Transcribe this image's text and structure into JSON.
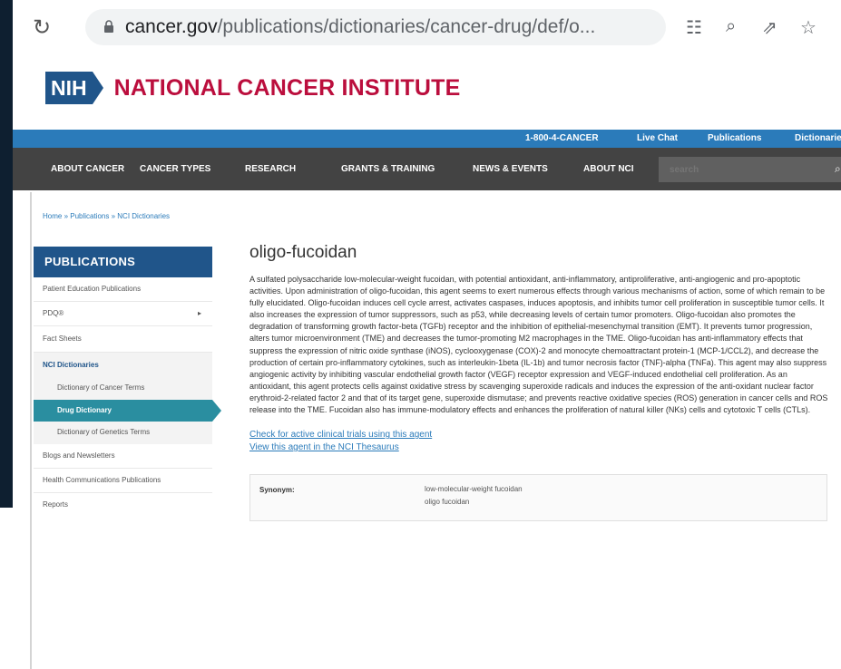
{
  "browser": {
    "url_domain": "cancer.gov",
    "url_path": "/publications/dictionaries/cancer-drug/def/o..."
  },
  "header": {
    "nih_logo": "NIH",
    "institute_name": "NATIONAL CANCER INSTITUTE",
    "colors": {
      "nih_blue": "#20558a",
      "brand_red": "#bb0e3d",
      "utility_blue": "#2b7bba",
      "nav_gray": "#434343",
      "active_teal": "#2a8ea0"
    }
  },
  "utility_nav": [
    "1-800-4-CANCER",
    "Live Chat",
    "Publications",
    "Dictionaries"
  ],
  "main_nav": {
    "items": [
      "ABOUT CANCER",
      "CANCER TYPES",
      "RESEARCH",
      "GRANTS & TRAINING",
      "NEWS & EVENTS",
      "ABOUT NCI"
    ],
    "search_placeholder": "search"
  },
  "breadcrumb": "Home » Publications » NCI Dictionaries",
  "sidebar": {
    "title": "PUBLICATIONS",
    "items": {
      "patient_education": "Patient Education Publications",
      "pdq": "PDQ®",
      "fact_sheets": "Fact Sheets",
      "nci_dictionaries": "NCI Dictionaries",
      "dict_cancer_terms": "Dictionary of Cancer Terms",
      "drug_dictionary": "Drug Dictionary",
      "dict_genetics_terms": "Dictionary of Genetics Terms",
      "blogs": "Blogs and Newsletters",
      "health_comm": "Health Communications Publications",
      "reports": "Reports"
    }
  },
  "main": {
    "term": "oligo-fucoidan",
    "definition": "A sulfated polysaccharide low-molecular-weight fucoidan, with potential antioxidant, anti-inflammatory, antiproliferative, anti-angiogenic and pro-apoptotic activities. Upon administration of oligo-fucoidan, this agent seems to exert numerous effects through various mechanisms of action, some of which remain to be fully elucidated. Oligo-fucoidan induces cell cycle arrest, activates caspases, induces apoptosis, and inhibits tumor cell proliferation in susceptible tumor cells. It also increases the expression of tumor suppressors, such as p53, while decreasing levels of certain tumor promoters. Oligo-fucoidan also promotes the degradation of transforming growth factor-beta (TGFb) receptor and the inhibition of epithelial-mesenchymal transition (EMT). It prevents tumor progression, alters tumor microenvironment (TME) and decreases the tumor-promoting M2 macrophages in the TME. Oligo-fucoidan has anti-inflammatory effects that suppress the expression of nitric oxide synthase (iNOS), cyclooxygenase (COX)-2 and monocyte chemoattractant protein-1 (MCP-1/CCL2), and decrease the production of certain pro-inflammatory cytokines, such as interleukin-1beta (IL-1b) and tumor necrosis factor (TNF)-alpha (TNFa). This agent may also suppress angiogenic activity by inhibiting vascular endothelial growth factor (VEGF) receptor expression and VEGF-induced endothelial cell proliferation. As an antioxidant, this agent protects cells against oxidative stress by scavenging superoxide radicals and induces the expression of the anti-oxidant nuclear factor erythroid-2-related factor 2 and that of its target gene, superoxide dismutase; and prevents reactive oxidative species (ROS) generation in cancer cells and ROS release into the TME. Fucoidan also has immune-modulatory effects and enhances the proliferation of natural killer (NKs) cells and cytotoxic T cells (CTLs).",
    "link_trials": "Check for active clinical trials using this agent",
    "link_thesaurus": "View this agent in the NCI Thesaurus",
    "synonym_label": "Synonym:",
    "synonyms": [
      "low-molecular-weight fucoidan",
      "oligo fucoidan"
    ]
  }
}
